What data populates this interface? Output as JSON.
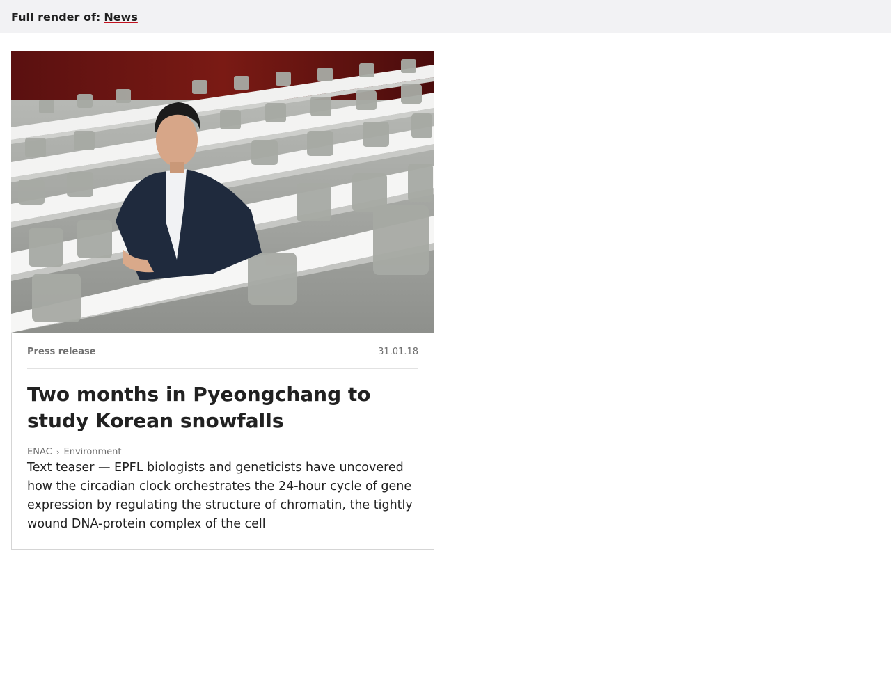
{
  "header": {
    "prefix": "Full render of:",
    "link_label": "News"
  },
  "card": {
    "image_alt": "Man in a dark blazer seated in an empty lecture hall with rows of white desks and chairs",
    "type": "Press release",
    "date": "31.01.18",
    "title": "Two months in Pyeongchang to study Korean snowfalls",
    "breadcrumbs": [
      "ENAC",
      "Environment"
    ],
    "breadcrumb_separator": "›",
    "teaser": "Text teaser — EPFL biologists and geneticists have uncovered how the circadian clock orchestrates the 24-hour cycle of gene expression by regulating the structure of chromatin, the tightly wound DNA-protein complex of the cell"
  },
  "colors": {
    "accent": "#c1121f",
    "topbar_bg": "#f2f2f4",
    "text": "#212121",
    "muted": "#707070"
  }
}
